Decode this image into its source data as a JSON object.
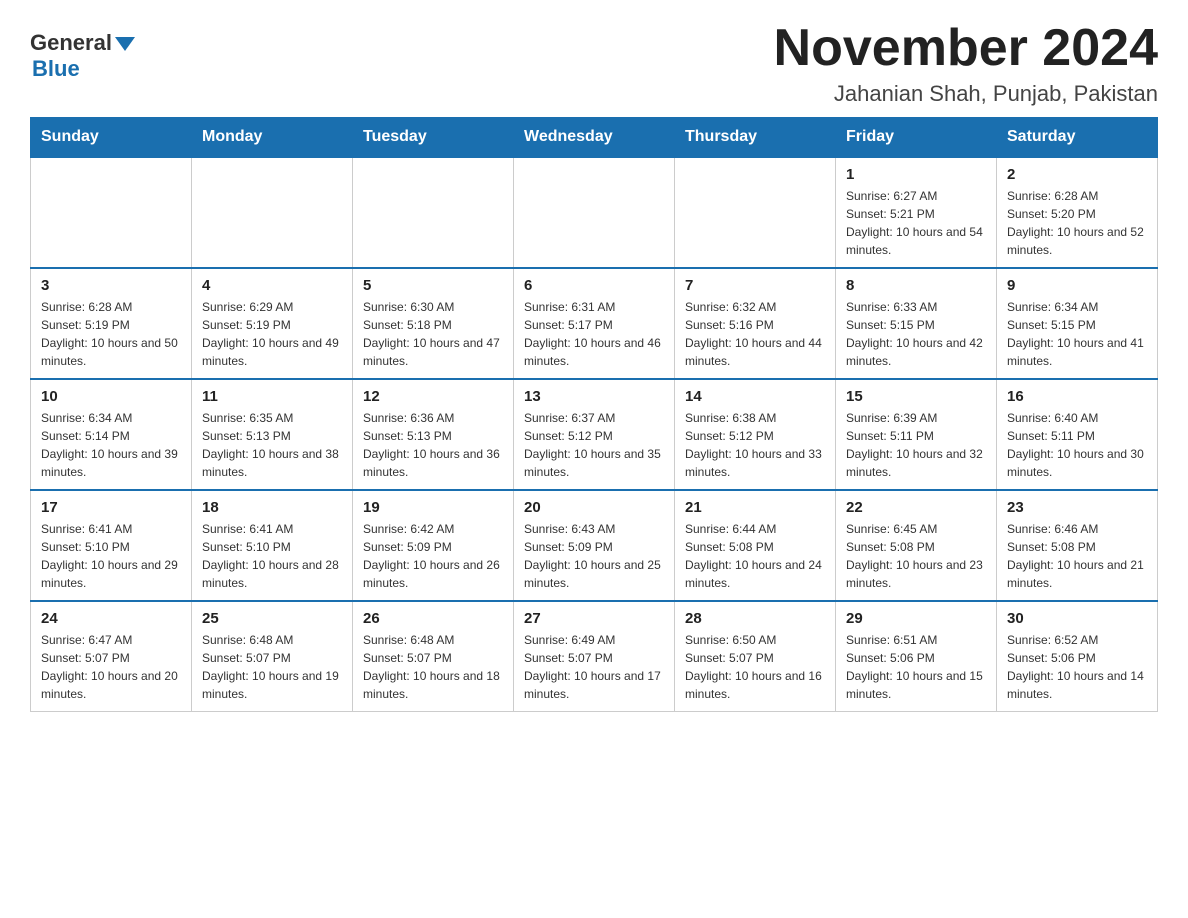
{
  "header": {
    "logo_general": "General",
    "logo_blue": "Blue",
    "title": "November 2024",
    "subtitle": "Jahanian Shah, Punjab, Pakistan"
  },
  "days_of_week": [
    "Sunday",
    "Monday",
    "Tuesday",
    "Wednesday",
    "Thursday",
    "Friday",
    "Saturday"
  ],
  "weeks": [
    [
      {
        "day": "",
        "info": ""
      },
      {
        "day": "",
        "info": ""
      },
      {
        "day": "",
        "info": ""
      },
      {
        "day": "",
        "info": ""
      },
      {
        "day": "",
        "info": ""
      },
      {
        "day": "1",
        "info": "Sunrise: 6:27 AM\nSunset: 5:21 PM\nDaylight: 10 hours and 54 minutes."
      },
      {
        "day": "2",
        "info": "Sunrise: 6:28 AM\nSunset: 5:20 PM\nDaylight: 10 hours and 52 minutes."
      }
    ],
    [
      {
        "day": "3",
        "info": "Sunrise: 6:28 AM\nSunset: 5:19 PM\nDaylight: 10 hours and 50 minutes."
      },
      {
        "day": "4",
        "info": "Sunrise: 6:29 AM\nSunset: 5:19 PM\nDaylight: 10 hours and 49 minutes."
      },
      {
        "day": "5",
        "info": "Sunrise: 6:30 AM\nSunset: 5:18 PM\nDaylight: 10 hours and 47 minutes."
      },
      {
        "day": "6",
        "info": "Sunrise: 6:31 AM\nSunset: 5:17 PM\nDaylight: 10 hours and 46 minutes."
      },
      {
        "day": "7",
        "info": "Sunrise: 6:32 AM\nSunset: 5:16 PM\nDaylight: 10 hours and 44 minutes."
      },
      {
        "day": "8",
        "info": "Sunrise: 6:33 AM\nSunset: 5:15 PM\nDaylight: 10 hours and 42 minutes."
      },
      {
        "day": "9",
        "info": "Sunrise: 6:34 AM\nSunset: 5:15 PM\nDaylight: 10 hours and 41 minutes."
      }
    ],
    [
      {
        "day": "10",
        "info": "Sunrise: 6:34 AM\nSunset: 5:14 PM\nDaylight: 10 hours and 39 minutes."
      },
      {
        "day": "11",
        "info": "Sunrise: 6:35 AM\nSunset: 5:13 PM\nDaylight: 10 hours and 38 minutes."
      },
      {
        "day": "12",
        "info": "Sunrise: 6:36 AM\nSunset: 5:13 PM\nDaylight: 10 hours and 36 minutes."
      },
      {
        "day": "13",
        "info": "Sunrise: 6:37 AM\nSunset: 5:12 PM\nDaylight: 10 hours and 35 minutes."
      },
      {
        "day": "14",
        "info": "Sunrise: 6:38 AM\nSunset: 5:12 PM\nDaylight: 10 hours and 33 minutes."
      },
      {
        "day": "15",
        "info": "Sunrise: 6:39 AM\nSunset: 5:11 PM\nDaylight: 10 hours and 32 minutes."
      },
      {
        "day": "16",
        "info": "Sunrise: 6:40 AM\nSunset: 5:11 PM\nDaylight: 10 hours and 30 minutes."
      }
    ],
    [
      {
        "day": "17",
        "info": "Sunrise: 6:41 AM\nSunset: 5:10 PM\nDaylight: 10 hours and 29 minutes."
      },
      {
        "day": "18",
        "info": "Sunrise: 6:41 AM\nSunset: 5:10 PM\nDaylight: 10 hours and 28 minutes."
      },
      {
        "day": "19",
        "info": "Sunrise: 6:42 AM\nSunset: 5:09 PM\nDaylight: 10 hours and 26 minutes."
      },
      {
        "day": "20",
        "info": "Sunrise: 6:43 AM\nSunset: 5:09 PM\nDaylight: 10 hours and 25 minutes."
      },
      {
        "day": "21",
        "info": "Sunrise: 6:44 AM\nSunset: 5:08 PM\nDaylight: 10 hours and 24 minutes."
      },
      {
        "day": "22",
        "info": "Sunrise: 6:45 AM\nSunset: 5:08 PM\nDaylight: 10 hours and 23 minutes."
      },
      {
        "day": "23",
        "info": "Sunrise: 6:46 AM\nSunset: 5:08 PM\nDaylight: 10 hours and 21 minutes."
      }
    ],
    [
      {
        "day": "24",
        "info": "Sunrise: 6:47 AM\nSunset: 5:07 PM\nDaylight: 10 hours and 20 minutes."
      },
      {
        "day": "25",
        "info": "Sunrise: 6:48 AM\nSunset: 5:07 PM\nDaylight: 10 hours and 19 minutes."
      },
      {
        "day": "26",
        "info": "Sunrise: 6:48 AM\nSunset: 5:07 PM\nDaylight: 10 hours and 18 minutes."
      },
      {
        "day": "27",
        "info": "Sunrise: 6:49 AM\nSunset: 5:07 PM\nDaylight: 10 hours and 17 minutes."
      },
      {
        "day": "28",
        "info": "Sunrise: 6:50 AM\nSunset: 5:07 PM\nDaylight: 10 hours and 16 minutes."
      },
      {
        "day": "29",
        "info": "Sunrise: 6:51 AM\nSunset: 5:06 PM\nDaylight: 10 hours and 15 minutes."
      },
      {
        "day": "30",
        "info": "Sunrise: 6:52 AM\nSunset: 5:06 PM\nDaylight: 10 hours and 14 minutes."
      }
    ]
  ]
}
